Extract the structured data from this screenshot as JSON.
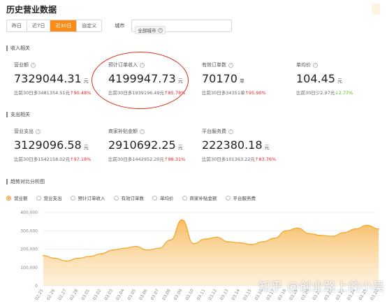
{
  "page": {
    "title": "历史营业数据"
  },
  "filters": {
    "date_options": [
      "昨日",
      "近7日",
      "近30日",
      "自定义"
    ],
    "active_index": 2,
    "city_label": "城市",
    "city_tag": "全部城市"
  },
  "income": {
    "section_label": "收入相关",
    "metrics": [
      {
        "name": "营业额",
        "value": "7329044.31",
        "unit": "元",
        "compare": "比前30日多3481354.51元",
        "pct": "↑90.48%",
        "trend": "up"
      },
      {
        "name": "预计订单收入",
        "value": "4199947.73",
        "unit": "元",
        "compare": "比前30日多1939196.49元",
        "pct": "↑85.78%",
        "trend": "up"
      },
      {
        "name": "有效订单数",
        "value": "70170",
        "unit": "单",
        "compare": "比前30日多34351单",
        "pct": "↑95.90%",
        "trend": "up"
      },
      {
        "name": "单均价",
        "value": "104.45",
        "unit": "元",
        "compare": "比前30日少2.97元",
        "pct": "↓2.77%",
        "trend": "down"
      }
    ]
  },
  "expense": {
    "section_label": "支出相关",
    "metrics": [
      {
        "name": "营业支出",
        "value": "3129096.58",
        "unit": "元",
        "compare": "比前30日多1542158.02元",
        "pct": "↑97.18%",
        "trend": "up"
      },
      {
        "name": "商家补贴金额",
        "value": "2910692.25",
        "unit": "元",
        "compare": "比前30日多1442952.20元",
        "pct": "↑98.31%",
        "trend": "up"
      },
      {
        "name": "平台服务费",
        "value": "222380.18",
        "unit": "元",
        "compare": "比前30日多101363.22元",
        "pct": "↑83.76%",
        "trend": "up"
      }
    ]
  },
  "trend": {
    "section_label": "趋势对比分析图",
    "legend": [
      "营业额",
      "营业支出",
      "预计订单收入",
      "有效订单数",
      "单均价",
      "商家补贴金额",
      "平台服务费"
    ],
    "active_legend": 0
  },
  "chart_data": {
    "type": "area",
    "series": [
      {
        "values": [
          165000,
          150000,
          135000,
          150000,
          160000,
          175000,
          195000,
          205000,
          215000,
          195000,
          205000,
          250000,
          360000,
          230000,
          255000,
          265000,
          240000,
          235000,
          225000,
          240000,
          260000,
          300000,
          315000,
          285000,
          275000,
          270000,
          290000,
          310000,
          330000,
          310000
        ]
      }
    ],
    "x": [
      "02.25",
      "02.26",
      "02.27",
      "02.28",
      "03.01",
      "03.02",
      "03.03",
      "03.04",
      "03.05",
      "03.06",
      "03.07",
      "03.08",
      "03.09",
      "03.10",
      "03.11",
      "03.12",
      "03.13",
      "03.14",
      "03.15",
      "03.16",
      "03.17",
      "03.18",
      "03.19",
      "03.20",
      "03.21",
      "03.22",
      "03.23",
      "03.24",
      "03.25",
      "03.26"
    ],
    "yticks": [
      "400,000",
      "300,000",
      "200,000",
      "100,000",
      "0"
    ],
    "ylim": [
      0,
      400000
    ],
    "grid": true,
    "color": "#f5a623"
  },
  "watermark": "知乎 @创业路上的小吴"
}
